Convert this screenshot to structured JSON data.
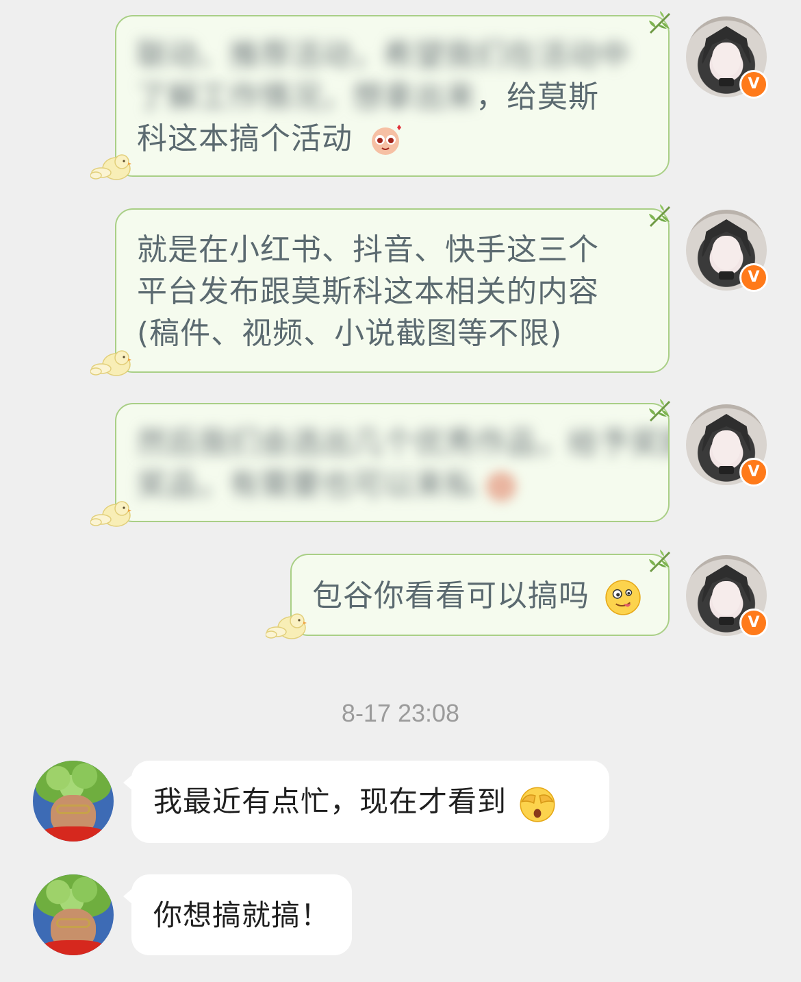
{
  "messages": [
    {
      "id": "m1",
      "side": "outgoing",
      "blurred_line1": "联动、推荐活动，希望我们在活动中",
      "blurred_line2_prefix": "了解工作情况，想拿出来",
      "line2_suffix": "，给莫斯",
      "line3": "科这本搞个活动",
      "emoji": "blush-sticker"
    },
    {
      "id": "m2",
      "side": "outgoing",
      "lines": [
        "就是在小红书、抖音、快手这三个",
        "平台发布跟莫斯科这本相关的内容",
        "(稿件、视频、小说截图等不限)"
      ]
    },
    {
      "id": "m3",
      "side": "outgoing",
      "blurred_line1": "然后我们会选出几个优秀作品，给予奖励",
      "blurred_line2": "奖品，有需要也可以来私"
    },
    {
      "id": "m4",
      "side": "outgoing",
      "text": "包谷你看看可以搞吗",
      "emoji": "tongue-out-emoji"
    }
  ],
  "timestamp": "8-17 23:08",
  "replies": [
    {
      "id": "r1",
      "text": "我最近有点忙，现在才看到",
      "emoji": "see-no-evil-emoji"
    },
    {
      "id": "r2",
      "text": "你想搞就搞！"
    }
  ],
  "badge": {
    "letter": "V",
    "color": "#ff7a1a"
  },
  "colors": {
    "background": "#efefef",
    "outgoing_bubble": "#f5fbee",
    "outgoing_border": "#a9cf86",
    "incoming_bubble": "#ffffff"
  }
}
